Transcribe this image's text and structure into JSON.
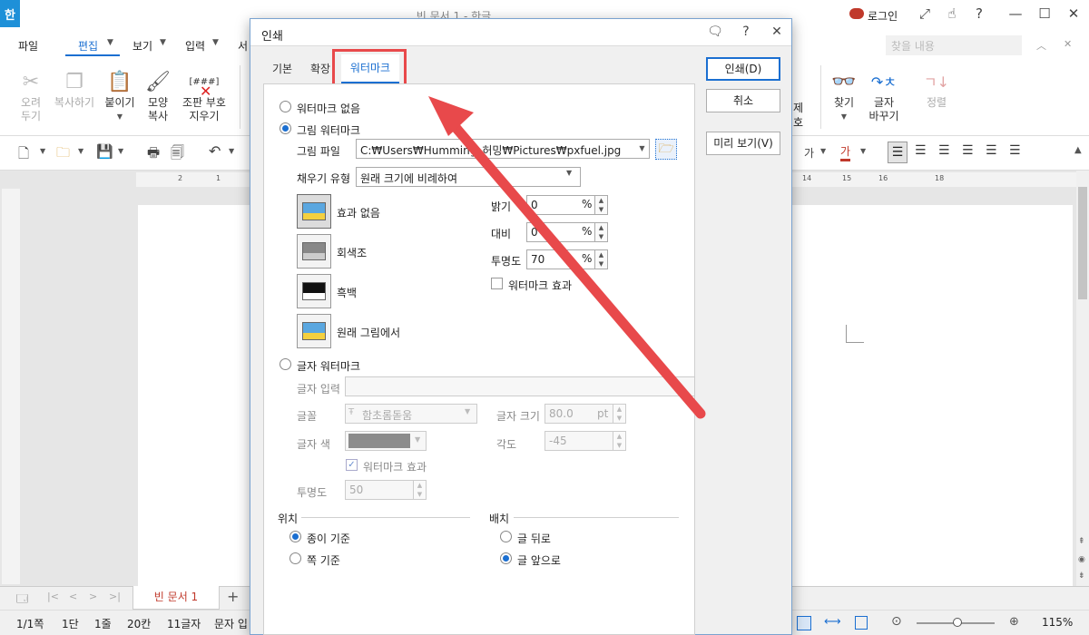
{
  "window": {
    "app_icon": "한",
    "title": "빈 문서 1 - 한글",
    "login_label": "로그인",
    "search_placeholder": "찾을 내용"
  },
  "menu": {
    "items": [
      "파일",
      "편집",
      "보기",
      "입력",
      "서"
    ],
    "active": "편집"
  },
  "ribbon": {
    "left_buttons": [
      {
        "label": "오려\n두기",
        "icon": "scissors-icon",
        "disabled": true
      },
      {
        "label": "복사하기",
        "icon": "copy-icon",
        "disabled": true
      },
      {
        "label": "붙이기",
        "icon": "paste-icon",
        "disabled": false
      },
      {
        "label": "모양\n복사",
        "icon": "format-painter-icon",
        "disabled": false
      },
      {
        "label": "조판 부호\n지우기",
        "icon": "clear-code-icon",
        "disabled": false
      }
    ],
    "right_buttons": [
      {
        "label": "찾기",
        "icon": "binoculars-icon",
        "disabled": false
      },
      {
        "label": "글자\n바꾸기",
        "icon": "replace-text-icon",
        "disabled": false
      },
      {
        "label": "정렬",
        "icon": "sort-icon",
        "disabled": true
      }
    ],
    "partial_labels": [
      "제",
      "호"
    ],
    "clear_code_icon_text": "[###]"
  },
  "toolbar": {
    "font_color_letter": "가"
  },
  "ruler": {
    "h_ticks": [
      "2",
      "1",
      "14",
      "15",
      "16",
      "18"
    ]
  },
  "tabs": {
    "doc_tab": "빈 문서 1",
    "add_label": "+"
  },
  "status": {
    "page": "1/1쪽",
    "section": "1단",
    "line": "1줄",
    "col": "20칸",
    "chars": "11글자",
    "mode": "문자 입",
    "zoom": "115%"
  },
  "dialog": {
    "title": "인쇄",
    "tabs": [
      "기본",
      "확장",
      "워터마크"
    ],
    "active_tab": "워터마크",
    "buttons": {
      "print": "인쇄(D)",
      "cancel": "취소",
      "preview": "미리 보기(V)"
    },
    "no_watermark": "워터마크 없음",
    "image_watermark": "그림 워터마크",
    "image_file_label": "그림 파일",
    "image_file_path": "C:₩Users₩Humming_허밍₩Pictures₩pxfuel.jpg",
    "fill_type_label": "채우기 유형",
    "fill_type_value": "원래 크기에 비례하여",
    "effects": [
      {
        "label": "효과 없음",
        "icon": "no-effect-icon",
        "selected": true
      },
      {
        "label": "회색조",
        "icon": "grayscale-icon",
        "selected": false
      },
      {
        "label": "흑백",
        "icon": "black-white-icon",
        "selected": false
      },
      {
        "label": "원래 그림에서",
        "icon": "original-image-icon",
        "selected": false
      }
    ],
    "brightness_label": "밝기",
    "brightness_value": "0",
    "brightness_unit": "%",
    "contrast_label": "대비",
    "contrast_value": "0",
    "contrast_unit": "%",
    "transparency_label": "투명도",
    "transparency_value": "70",
    "transparency_unit": "%",
    "watermark_effect_label": "워터마크 효과",
    "text_watermark": "글자 워터마크",
    "text_input_label": "글자 입력",
    "font_label": "글꼴",
    "font_value": "함초롬돋움",
    "font_size_label": "글자 크기",
    "font_size_value": "80.0",
    "font_size_unit": "pt",
    "font_color_label": "글자 색",
    "angle_label": "각도",
    "angle_value": "-45",
    "text_watermark_effect_label": "워터마크 효과",
    "text_transparency_label": "투명도",
    "text_transparency_value": "50",
    "position_label": "위치",
    "position_options": [
      "종이 기준",
      "쪽 기준"
    ],
    "position_selected": "종이 기준",
    "layout_label": "배치",
    "layout_options": [
      "글 뒤로",
      "글 앞으로"
    ],
    "layout_selected": "글 앞으로"
  },
  "colors": {
    "accent": "#1b6fd1",
    "annotation_red": "#e8494b",
    "font_color_gray": "#8c8c8c"
  }
}
